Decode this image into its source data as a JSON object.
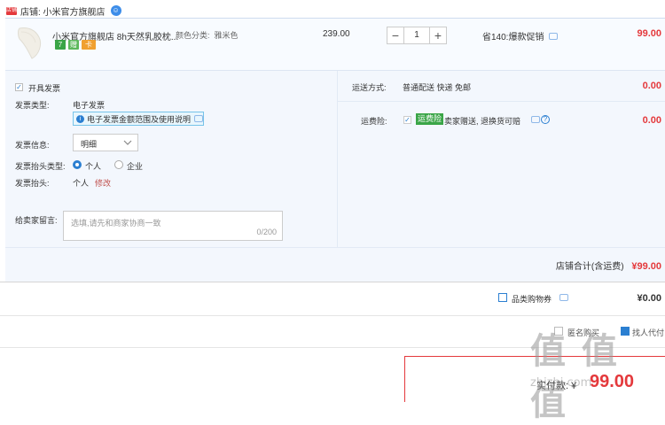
{
  "header": {
    "badge": "店铺",
    "shop_label": "店铺: 小米官方旗舰店"
  },
  "item": {
    "title": "小米官方旗舰店 8h天然乳胶枕...",
    "spec_label": "颜色分类:",
    "spec_value": "雅米色",
    "promo_tags": [
      {
        "text": "7",
        "color": "#3aa547"
      },
      {
        "text": "赠",
        "color": "#5cb85c"
      },
      {
        "text": "卡",
        "color": "#f0a030"
      }
    ],
    "unit_price": "239.00",
    "quantity": "1",
    "minus": "−",
    "plus": "+",
    "discount_text": "省140:爆款促销",
    "total": "99.00"
  },
  "invoice": {
    "issue_label": "开具发票",
    "type_label": "发票类型:",
    "type_value": "电子发票",
    "notice": "电子发票金额范围及使用说明",
    "info_label": "发票信息:",
    "info_value": "明细",
    "header_type_label": "发票抬头类型:",
    "options": [
      "个人",
      "企业"
    ],
    "header_label": "发票抬头:",
    "header_value": "个人",
    "modify": "修改"
  },
  "shipping": {
    "label": "运送方式:",
    "value": "普通配送 快递 免邮",
    "price": "0.00",
    "insurance_label": "运费险:",
    "insurance_badge": "运费险",
    "insurance_text": "卖家赠送, 退换货可赔",
    "insurance_price": "0.00"
  },
  "message": {
    "label": "给卖家留言:",
    "placeholder": "选填,请先和商家协商一致",
    "counter": "0/200"
  },
  "subtotal": {
    "label": "店铺合计(含运费)",
    "value": "¥99.00"
  },
  "coupon": {
    "label": "品类购物券",
    "value": "¥0.00"
  },
  "footer": {
    "option1": "匿名购买",
    "option2": "找人代付",
    "final_label": "实付款: ¥",
    "final_value": "99.00"
  },
  "watermark": {
    "text": "值 值 值",
    "sub": "zhizhi.com"
  },
  "colors": {
    "accent": "#e4393c",
    "blue": "#2b7fd1",
    "panel": "#f3f7fd"
  }
}
